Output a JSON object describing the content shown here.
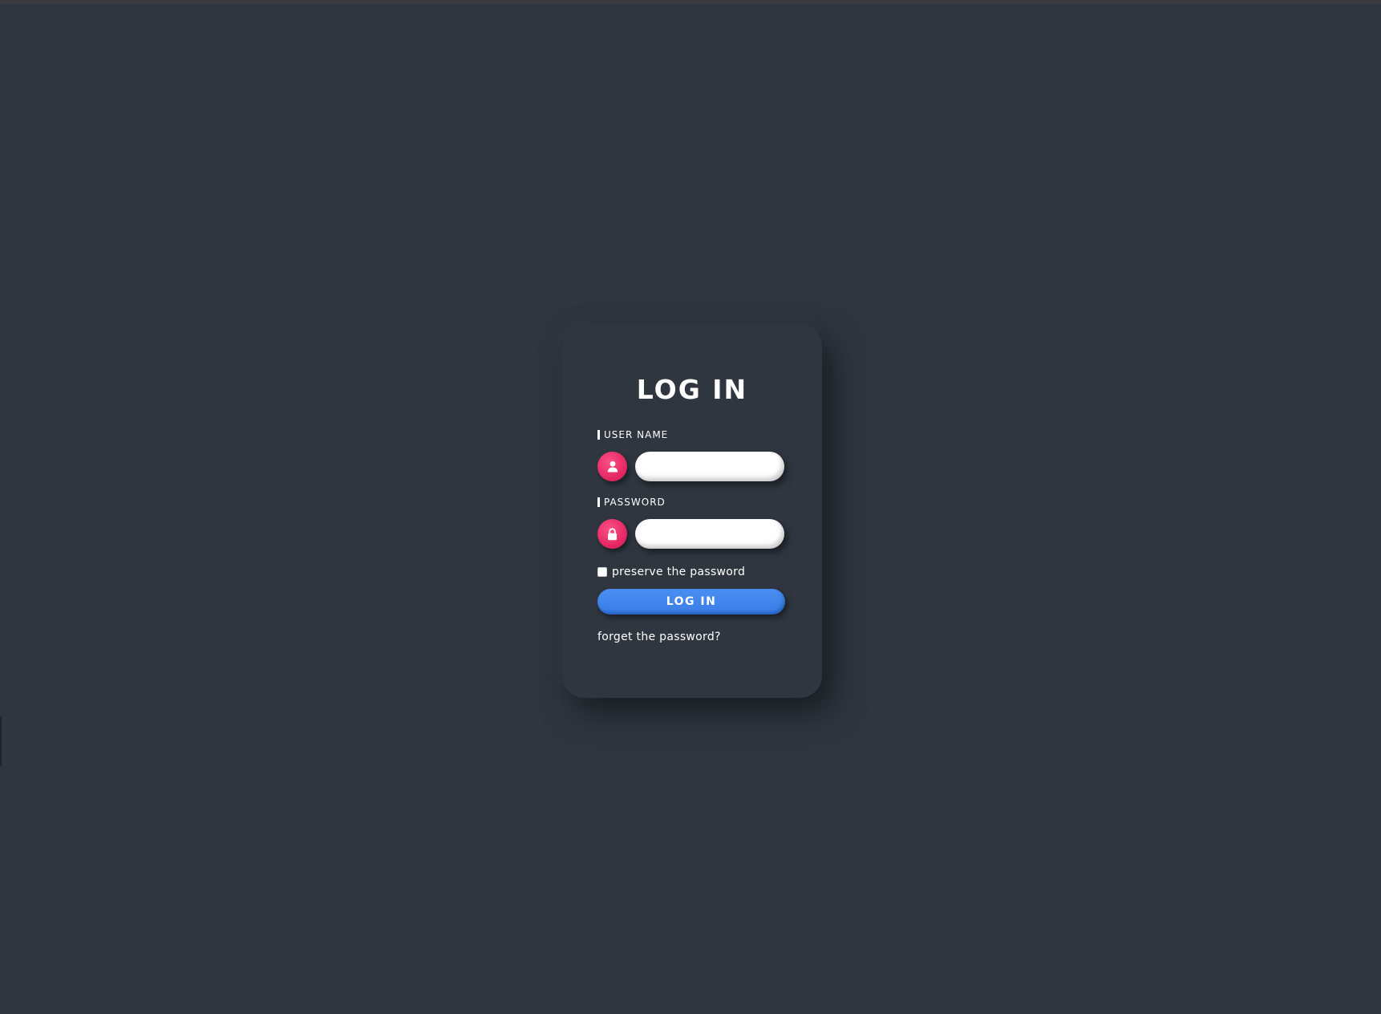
{
  "login_card": {
    "title": "LOG IN",
    "username": {
      "label": "USER NAME",
      "icon": "user-icon",
      "value": "",
      "placeholder": ""
    },
    "password": {
      "label": "PASSWORD",
      "icon": "lock-icon",
      "value": "",
      "placeholder": ""
    },
    "remember": {
      "label": "preserve the password",
      "checked": false
    },
    "submit_label": "LOG IN",
    "forgot_label": "forget the password?"
  },
  "colors": {
    "background": "#30363f",
    "icon_accent": "#e8306a",
    "button": "#3f84ed",
    "text": "#ffffff"
  }
}
